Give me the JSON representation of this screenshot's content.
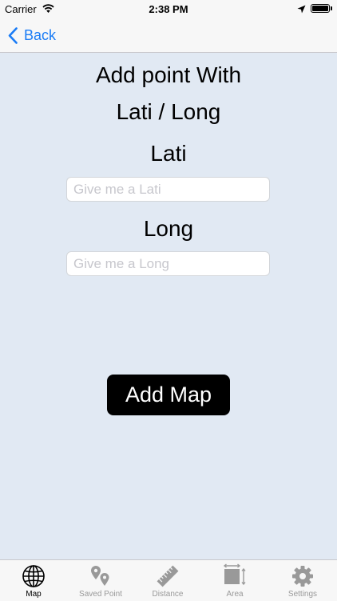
{
  "status_bar": {
    "carrier": "Carrier",
    "time": "2:38 PM"
  },
  "nav": {
    "back_label": "Back"
  },
  "main": {
    "title_line1": "Add point With",
    "title_line2": "Lati / Long",
    "lati_label": "Lati",
    "lati_value": "",
    "lati_placeholder": "Give me a Lati",
    "long_label": "Long",
    "long_value": "",
    "long_placeholder": "Give me a Long",
    "add_button_label": "Add Map"
  },
  "tabs": [
    {
      "label": "Map",
      "icon": "globe-icon",
      "active": true
    },
    {
      "label": "Saved Point",
      "icon": "map-pins-icon",
      "active": false
    },
    {
      "label": "Distance",
      "icon": "ruler-icon",
      "active": false
    },
    {
      "label": "Area",
      "icon": "area-icon",
      "active": false
    },
    {
      "label": "Settings",
      "icon": "gear-icon",
      "active": false
    }
  ],
  "colors": {
    "accent": "#1a7cf6",
    "background": "#e1e9f3",
    "button": "#000000"
  }
}
